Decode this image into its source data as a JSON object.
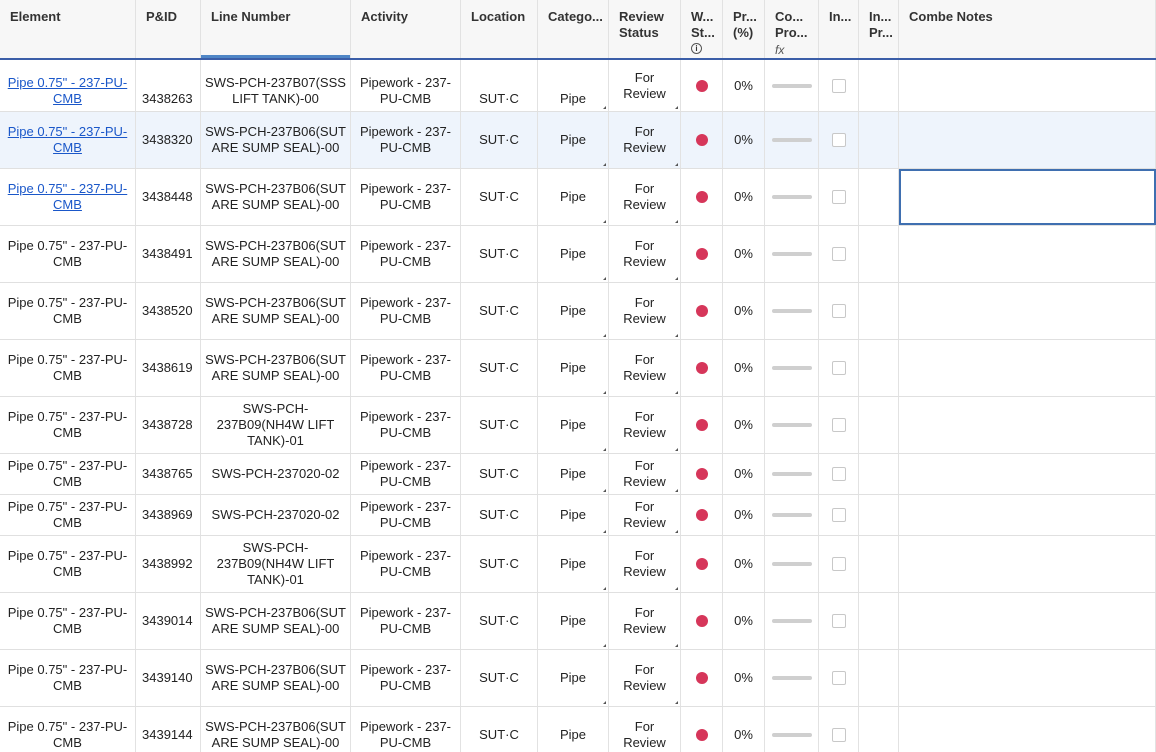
{
  "columns": [
    {
      "key": "element",
      "label": "Element"
    },
    {
      "key": "pid",
      "label": "P&ID"
    },
    {
      "key": "line",
      "label": "Line Number"
    },
    {
      "key": "activity",
      "label": "Activity"
    },
    {
      "key": "location",
      "label": "Location"
    },
    {
      "key": "category",
      "label": "Catego..."
    },
    {
      "key": "review",
      "label": "Review Status"
    },
    {
      "key": "wst",
      "label": "W... St..."
    },
    {
      "key": "pr",
      "label": "Pr... (%)"
    },
    {
      "key": "cop",
      "label": "Co... Pro..."
    },
    {
      "key": "in1",
      "label": "In..."
    },
    {
      "key": "in2",
      "label": "In... Pr..."
    },
    {
      "key": "notes",
      "label": "Combe Notes"
    }
  ],
  "formula_icon": "fx",
  "info_icon": "i",
  "status_color": "#d6365a",
  "rows": [
    {
      "element": "Pipe 0.75\" - 237-PU-CMB",
      "pid": "3438263",
      "line": "SWS-PCH-237B07(SSS LIFT TANK)-00",
      "activity": "Pipework - 237-PU-CMB",
      "location": "SUT·C",
      "category": "Pipe",
      "review": "For Review",
      "pr": "0%",
      "link": true
    },
    {
      "element": "Pipe 0.75\" - 237-PU-CMB",
      "pid": "3438320",
      "line": "SWS-PCH-237B06(SUT ARE SUMP SEAL)-00",
      "activity": "Pipework - 237-PU-CMB",
      "location": "SUT·C",
      "category": "Pipe",
      "review": "For Review",
      "pr": "0%",
      "link": true
    },
    {
      "element": "Pipe 0.75\" - 237-PU-CMB",
      "pid": "3438448",
      "line": "SWS-PCH-237B06(SUT ARE SUMP SEAL)-00",
      "activity": "Pipework - 237-PU-CMB",
      "location": "SUT·C",
      "category": "Pipe",
      "review": "For Review",
      "pr": "0%",
      "link": true
    },
    {
      "element": "Pipe 0.75\" - 237-PU-CMB",
      "pid": "3438491",
      "line": "SWS-PCH-237B06(SUT ARE SUMP SEAL)-00",
      "activity": "Pipework - 237-PU-CMB",
      "location": "SUT·C",
      "category": "Pipe",
      "review": "For Review",
      "pr": "0%"
    },
    {
      "element": "Pipe 0.75\" - 237-PU-CMB",
      "pid": "3438520",
      "line": "SWS-PCH-237B06(SUT ARE SUMP SEAL)-00",
      "activity": "Pipework - 237-PU-CMB",
      "location": "SUT·C",
      "category": "Pipe",
      "review": "For Review",
      "pr": "0%"
    },
    {
      "element": "Pipe 0.75\" - 237-PU-CMB",
      "pid": "3438619",
      "line": "SWS-PCH-237B06(SUT ARE SUMP SEAL)-00",
      "activity": "Pipework - 237-PU-CMB",
      "location": "SUT·C",
      "category": "Pipe",
      "review": "For Review",
      "pr": "0%"
    },
    {
      "element": "Pipe 0.75\" - 237-PU-CMB",
      "pid": "3438728",
      "line": "SWS-PCH-237B09(NH4W LIFT TANK)-01",
      "activity": "Pipework - 237-PU-CMB",
      "location": "SUT·C",
      "category": "Pipe",
      "review": "For Review",
      "pr": "0%"
    },
    {
      "element": "Pipe 0.75\" - 237-PU-CMB",
      "pid": "3438765",
      "line": "SWS-PCH-237020-02",
      "activity": "Pipework - 237-PU-CMB",
      "location": "SUT·C",
      "category": "Pipe",
      "review": "For Review",
      "pr": "0%",
      "short": true
    },
    {
      "element": "Pipe 0.75\" - 237-PU-CMB",
      "pid": "3438969",
      "line": "SWS-PCH-237020-02",
      "activity": "Pipework - 237-PU-CMB",
      "location": "SUT·C",
      "category": "Pipe",
      "review": "For Review",
      "pr": "0%",
      "short": true
    },
    {
      "element": "Pipe 0.75\" - 237-PU-CMB",
      "pid": "3438992",
      "line": "SWS-PCH-237B09(NH4W LIFT TANK)-01",
      "activity": "Pipework - 237-PU-CMB",
      "location": "SUT·C",
      "category": "Pipe",
      "review": "For Review",
      "pr": "0%"
    },
    {
      "element": "Pipe 0.75\" - 237-PU-CMB",
      "pid": "3439014",
      "line": "SWS-PCH-237B06(SUT ARE SUMP SEAL)-00",
      "activity": "Pipework - 237-PU-CMB",
      "location": "SUT·C",
      "category": "Pipe",
      "review": "For Review",
      "pr": "0%"
    },
    {
      "element": "Pipe 0.75\" - 237-PU-CMB",
      "pid": "3439140",
      "line": "SWS-PCH-237B06(SUT ARE SUMP SEAL)-00",
      "activity": "Pipework - 237-PU-CMB",
      "location": "SUT·C",
      "category": "Pipe",
      "review": "For Review",
      "pr": "0%"
    },
    {
      "element": "Pipe 0.75\" - 237-PU-CMB",
      "pid": "3439144",
      "line": "SWS-PCH-237B06(SUT ARE SUMP SEAL)-00",
      "activity": "Pipework - 237-PU-CMB",
      "location": "SUT·C",
      "category": "Pipe",
      "review": "For Review",
      "pr": "0%"
    }
  ]
}
